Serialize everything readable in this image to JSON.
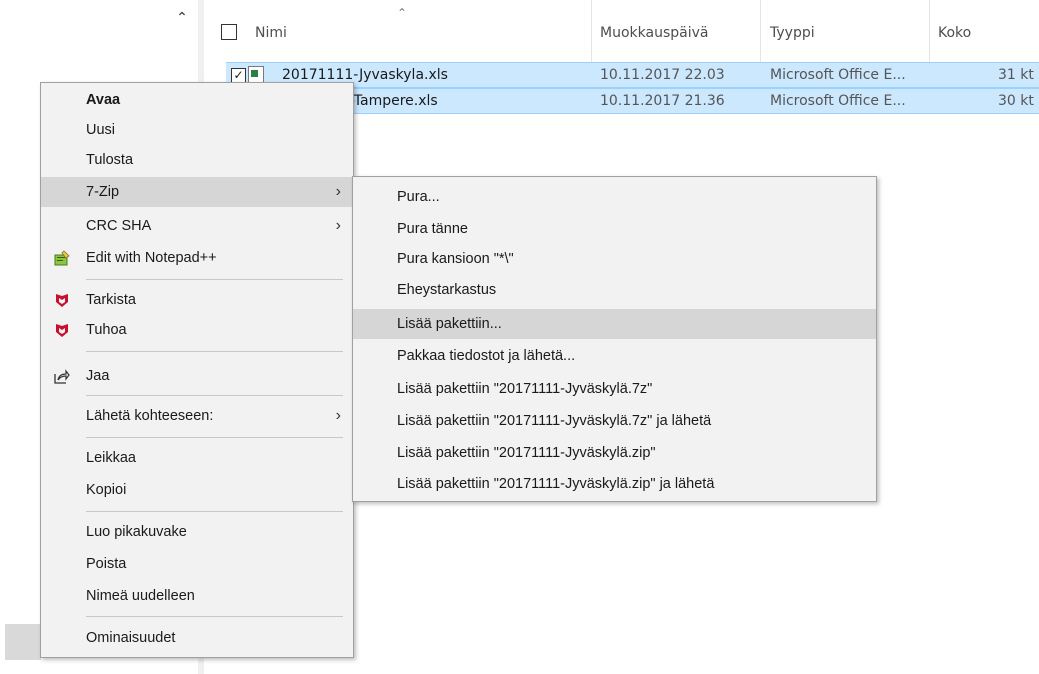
{
  "columns": {
    "name": "Nimi",
    "modified": "Muokkauspäivä",
    "type": "Tyyppi",
    "size": "Koko"
  },
  "files": [
    {
      "name_prefix": "20171111",
      "name_visible": "20171111-Jyvaskyla.xls",
      "modified": "10.11.2017 22.03",
      "type": "Microsoft Office E...",
      "size": "31 kt"
    },
    {
      "name_visible": "-Tampere.xls",
      "modified": "10.11.2017 21.36",
      "type": "Microsoft Office E...",
      "size": "30 kt"
    }
  ],
  "context_menu": {
    "open": "Avaa",
    "new": "Uusi",
    "print": "Tulosta",
    "zip": "7-Zip",
    "crc": "CRC SHA",
    "notepad": "Edit with Notepad++",
    "scan": "Tarkista",
    "shred": "Tuhoa",
    "share": "Jaa",
    "send_to": "Lähetä kohteeseen:",
    "cut": "Leikkaa",
    "copy": "Kopioi",
    "shortcut": "Luo pikakuvake",
    "delete": "Poista",
    "rename": "Nimeä uudelleen",
    "properties": "Ominaisuudet"
  },
  "zip_submenu": [
    "Pura...",
    "Pura tänne",
    "Pura kansioon \"*\\\"",
    "Eheystarkastus",
    "Lisää pakettiin...",
    "Pakkaa tiedostot ja lähetä...",
    "Lisää pakettiin \"20171111-Jyväskylä.7z\"",
    "Lisää pakettiin \"20171111-Jyväskylä.7z\" ja lähetä",
    "Lisää pakettiin \"20171111-Jyväskylä.zip\"",
    "Lisää pakettiin \"20171111-Jyväskylä.zip\" ja lähetä"
  ],
  "icons": {
    "notepad": "notepad-plus-plus-icon",
    "mcafee": "mcafee-shield-icon",
    "share": "share-icon",
    "xls": "excel-file-icon"
  },
  "colors": {
    "selection": "#cce8ff",
    "menu_bg": "#f2f2f2",
    "menu_highlight": "#d6d6d6",
    "mcafee_red": "#c8102e"
  }
}
